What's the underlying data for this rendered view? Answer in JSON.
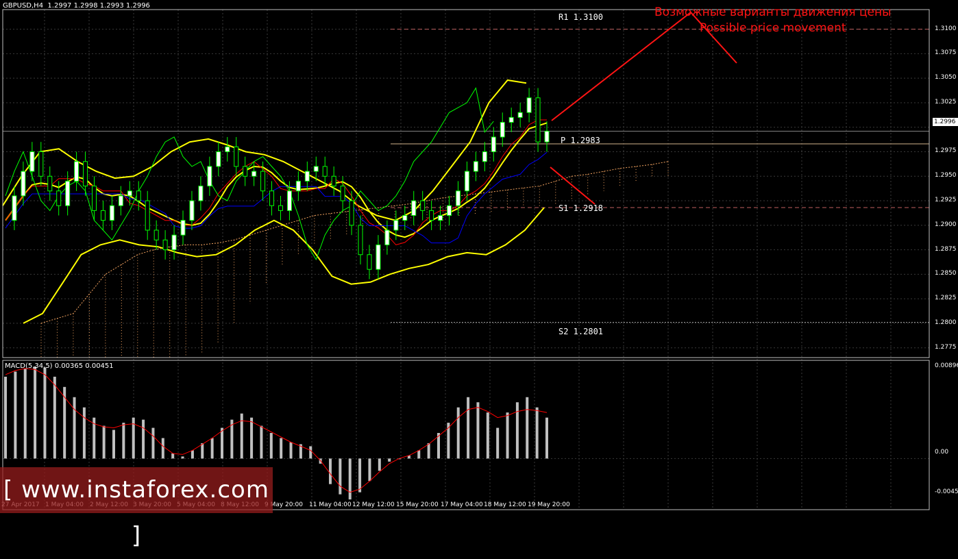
{
  "window": {
    "title": "GBPUSD,H4  1.2997 1.2998 1.2993 1.2996"
  },
  "annotation": {
    "line_ru": "Возможные варианты движения цены",
    "line_en": "Possible price movement",
    "color": "#ff1414"
  },
  "levels": {
    "r1": "R1 1.3100",
    "p": "P 1.2983",
    "s1": "S1 1.2918",
    "s2": "S2 1.2801"
  },
  "current_price": "1.2996",
  "price_axis": [
    "1.3100",
    "1.3075",
    "1.3050",
    "1.3025",
    "1.2975",
    "1.2950",
    "1.2925",
    "1.2900",
    "1.2875",
    "1.2850",
    "1.2825",
    "1.2800",
    "1.2775"
  ],
  "macd": {
    "label": "MACD(5,34,5) 0.00365 0.00451",
    "axis": [
      "0.00896",
      "0.00",
      "-0.0045"
    ]
  },
  "time_axis": [
    "27 Apr 2017",
    "1 May 04:00",
    "2 May 12:00",
    "3 May 20:00",
    "5 May 04:00",
    "8 May 12:00",
    "9 May 20:00",
    "11 May 04:00",
    "12 May 12:00",
    "15 May 20:00",
    "17 May 04:00",
    "18 May 12:00",
    "19 May 20:00"
  ],
  "watermark": "[  www.instaforex.com  ]",
  "chart_data": {
    "type": "line",
    "symbol": "GBPUSD",
    "timeframe": "H4",
    "colors": {
      "price_line": "#00ff00",
      "candles": "#00ff00",
      "bollinger": "#ffff00",
      "kijun": "#ff0000",
      "tenkan": "#0000ff",
      "cloud": "#f4a460",
      "macd_hist": "#c0c0c0",
      "macd_signal": "#ff0000",
      "levels": "#d2b48c"
    },
    "ylim": [
      1.2765,
      1.312
    ],
    "pivot_levels": [
      {
        "name": "R1",
        "value": 1.31
      },
      {
        "name": "P",
        "value": 1.2983
      },
      {
        "name": "S1",
        "value": 1.2918
      },
      {
        "name": "S2",
        "value": 1.2801
      }
    ],
    "close_series": [
      1.2905,
      1.293,
      1.2955,
      1.2975,
      1.295,
      1.2935,
      1.292,
      1.2945,
      1.2965,
      1.294,
      1.2915,
      1.2905,
      1.292,
      1.293,
      1.2935,
      1.2925,
      1.2895,
      1.2885,
      1.2875,
      1.289,
      1.2905,
      1.2925,
      1.294,
      1.296,
      1.2975,
      1.298,
      1.296,
      1.295,
      1.2955,
      1.2935,
      1.292,
      1.2915,
      1.2935,
      1.2945,
      1.2955,
      1.296,
      1.295,
      1.294,
      1.2925,
      1.29,
      1.287,
      1.2855,
      1.288,
      1.2895,
      1.2905,
      1.291,
      1.2925,
      1.2915,
      1.2905,
      1.291,
      1.292,
      1.2935,
      1.2955,
      1.2965,
      1.2975,
      1.299,
      1.3005,
      1.301,
      1.3015,
      1.303,
      1.2985,
      1.2996
    ],
    "bollinger_upper": [
      1.292,
      1.295,
      1.2975,
      1.2978,
      1.2965,
      1.2955,
      1.2948,
      1.295,
      1.296,
      1.2975,
      1.2985,
      1.2988,
      1.2982,
      1.2975,
      1.2972,
      1.2965,
      1.2955,
      1.2945,
      1.2935,
      1.292,
      1.291,
      1.2905,
      1.2915,
      1.2935,
      1.296,
      1.2985,
      1.3025,
      1.3048,
      1.3045
    ],
    "bollinger_lower": [
      1.28,
      1.281,
      1.284,
      1.287,
      1.288,
      1.2885,
      1.288,
      1.2878,
      1.2872,
      1.2868,
      1.287,
      1.288,
      1.2895,
      1.2905,
      1.2895,
      1.2875,
      1.2848,
      1.284,
      1.2842,
      1.285,
      1.2856,
      1.286,
      1.2868,
      1.2872,
      1.287,
      1.288,
      1.2895,
      1.2918
    ],
    "macd_hist": [
      0.008,
      0.0085,
      0.0088,
      0.009,
      0.0089,
      0.008,
      0.007,
      0.006,
      0.005,
      0.004,
      0.0032,
      0.0028,
      0.0035,
      0.004,
      0.0038,
      0.003,
      0.002,
      0.0005,
      0.0002,
      0.0008,
      0.0015,
      0.002,
      0.003,
      0.0038,
      0.0044,
      0.004,
      0.0032,
      0.0025,
      0.002,
      0.0016,
      0.0014,
      0.0012,
      -0.0005,
      -0.0025,
      -0.0035,
      -0.004,
      -0.0033,
      -0.0022,
      -0.0012,
      -0.0003,
      0.0,
      0.0003,
      0.0008,
      0.0015,
      0.0025,
      0.0035,
      0.005,
      0.006,
      0.0055,
      0.0045,
      0.003,
      0.0045,
      0.0055,
      0.006,
      0.005,
      0.004
    ],
    "macd_signal": [
      0.0082,
      0.0086,
      0.0088,
      0.0087,
      0.0082,
      0.0072,
      0.006,
      0.0048,
      0.004,
      0.0034,
      0.0031,
      0.003,
      0.0033,
      0.0034,
      0.003,
      0.0022,
      0.0012,
      0.0005,
      0.0004,
      0.0008,
      0.0014,
      0.002,
      0.0027,
      0.0033,
      0.0037,
      0.0036,
      0.0031,
      0.0026,
      0.0021,
      0.0016,
      0.0012,
      0.0008,
      -0.0002,
      -0.0015,
      -0.0027,
      -0.0033,
      -0.003,
      -0.0022,
      -0.0013,
      -0.0005,
      0.0,
      0.0003,
      0.0008,
      0.0014,
      0.0022,
      0.003,
      0.004,
      0.0048,
      0.005,
      0.0046,
      0.004,
      0.0042,
      0.0046,
      0.0048,
      0.0047,
      0.0045
    ]
  }
}
